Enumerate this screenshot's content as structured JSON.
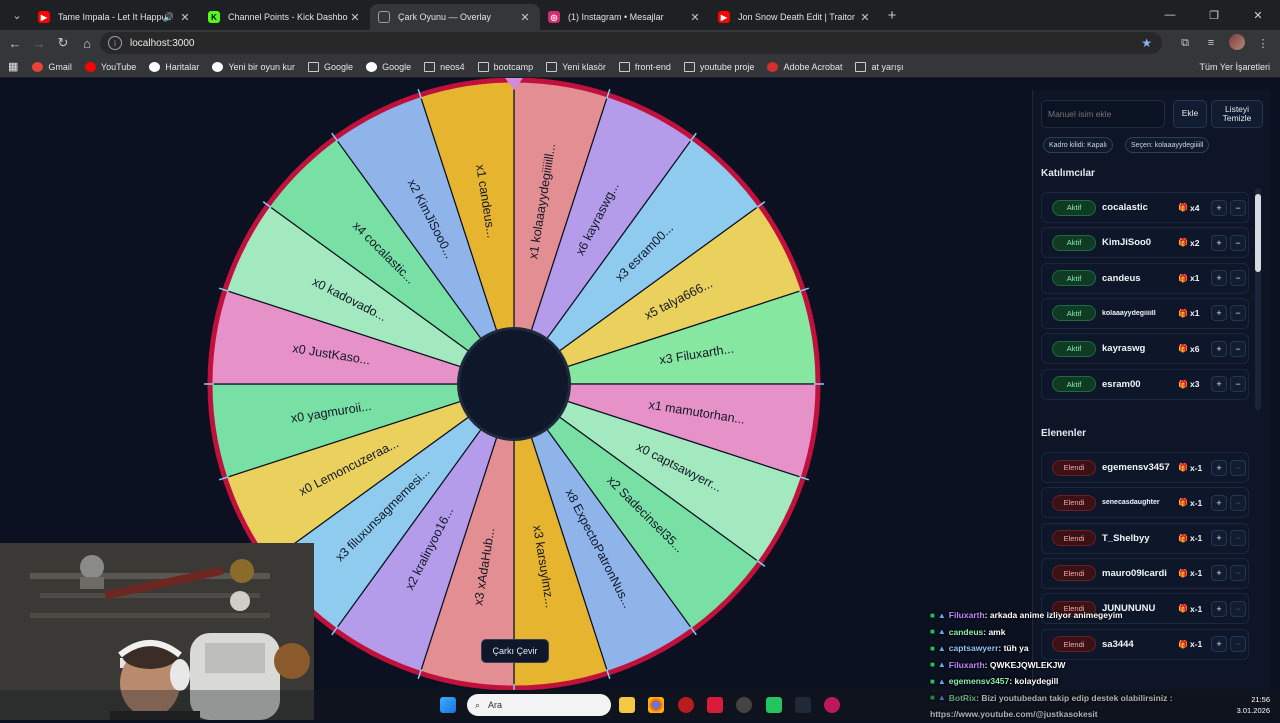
{
  "tabs": [
    {
      "title": "Tame Impala - Let It Happen",
      "color": "#ff0000",
      "glyph": "▶",
      "audio": true,
      "active": false
    },
    {
      "title": "Channel Points - Kick Dashboard",
      "color": "#53fc18",
      "glyph": "K",
      "audio": false,
      "active": false
    },
    {
      "title": "Çark Oyunu — Overlay",
      "color": "",
      "glyph": "",
      "audio": false,
      "active": true
    },
    {
      "title": "(1) Instagram • Mesajlar",
      "color": "#d62976",
      "glyph": "◎",
      "audio": false,
      "active": false
    },
    {
      "title": "Jon Snow Death Edit | Traitor",
      "color": "#ff0000",
      "glyph": "▶",
      "audio": false,
      "active": false
    }
  ],
  "address": {
    "url": "localhost:3000"
  },
  "bookmarks": [
    {
      "label": "Gmail",
      "icon": "gmail-icon",
      "color": "#ea4335"
    },
    {
      "label": "YouTube",
      "icon": "youtube-icon",
      "color": "#ff0000"
    },
    {
      "label": "Haritalar",
      "icon": "maps-icon",
      "color": "#ffffff"
    },
    {
      "label": "Yeni bir oyun kur",
      "icon": "page-icon",
      "color": "#ffffff"
    },
    {
      "label": "Google",
      "icon": "folder-icon",
      "color": ""
    },
    {
      "label": "Google",
      "icon": "google-icon",
      "color": "#ffffff"
    },
    {
      "label": "neos4",
      "icon": "folder-icon",
      "color": ""
    },
    {
      "label": "bootcamp",
      "icon": "folder-icon",
      "color": ""
    },
    {
      "label": "Yeni klasör",
      "icon": "folder-icon",
      "color": ""
    },
    {
      "label": "front-end",
      "icon": "folder-icon",
      "color": ""
    },
    {
      "label": "youtube proje",
      "icon": "folder-icon",
      "color": ""
    },
    {
      "label": "Adobe Acrobat",
      "icon": "acrobat-icon",
      "color": "#d32f2f"
    },
    {
      "label": "at yarışı",
      "icon": "folder-icon",
      "color": ""
    }
  ],
  "bookmarks_all": "Tüm Yer İşaretleri",
  "wheel": {
    "segments": [
      {
        "label": "x1 kolaaayydegiiiiill...",
        "color": "#e38e92"
      },
      {
        "label": "x6 kayraswg...",
        "color": "#b49cea"
      },
      {
        "label": "x3 esram00...",
        "color": "#8ecbee"
      },
      {
        "label": "x5 talya666...",
        "color": "#ead05c"
      },
      {
        "label": "x3 Filuxarth...",
        "color": "#86e8a0"
      },
      {
        "label": "x1 mamutorhan...",
        "color": "#e691c7"
      },
      {
        "label": "x0 captsawyerr...",
        "color": "#a2e9bf"
      },
      {
        "label": "x2 Sadecinsel35...",
        "color": "#78e0a4"
      },
      {
        "label": "x8 ExpectoPatronNus...",
        "color": "#8eb4ea"
      },
      {
        "label": "x3 karsuylmz...",
        "color": "#e7b42f"
      },
      {
        "label": "x3 xAdaHub...",
        "color": "#e38e92"
      },
      {
        "label": "x2 kralinyoo16...",
        "color": "#b49cea"
      },
      {
        "label": "x3 filuxunsagmemesi...",
        "color": "#8ecbee"
      },
      {
        "label": "x0 Lemoncuzeraa...",
        "color": "#ead05c"
      },
      {
        "label": "x0 yagmuroii...",
        "color": "#78e0a4"
      },
      {
        "label": "x0 JustKaso...",
        "color": "#e691c7"
      },
      {
        "label": "x0 kadovado...",
        "color": "#a2e9bf"
      },
      {
        "label": "x4 cocalastic...",
        "color": "#78e0a4"
      },
      {
        "label": "x2 KimJiSoo0...",
        "color": "#8eb4ea"
      },
      {
        "label": "x1 candeus...",
        "color": "#e7b42f"
      }
    ],
    "rim_color": "#c0113d",
    "hub_color": "#0f172a",
    "pointer_color": "#d18be0",
    "spin_label": "Çarkı Çevir"
  },
  "panel": {
    "input_placeholder": "Manuel isim ekle",
    "add_label": "Ekle",
    "clear_label": "Listeyi Temizle",
    "lock_chip": "Kadro kilidi: Kapalı",
    "chosen_chip": "Seçen: kolaaayydegiiiill",
    "participants_title": "Katılımcılar",
    "participants": [
      {
        "status": "Aktif",
        "name": "cocalastic",
        "mult": "x4"
      },
      {
        "status": "Aktif",
        "name": "KimJiSoo0",
        "mult": "x2"
      },
      {
        "status": "Aktif",
        "name": "candeus",
        "mult": "x1"
      },
      {
        "status": "Aktif",
        "name": "kolaaayydegiiiill",
        "mult": "x1"
      },
      {
        "status": "Aktif",
        "name": "kayraswg",
        "mult": "x6"
      },
      {
        "status": "Aktif",
        "name": "esram00",
        "mult": "x3"
      }
    ],
    "eliminated_title": "Elenenler",
    "eliminated": [
      {
        "status": "Elendi",
        "name": "egemensv3457",
        "mult": "x-1"
      },
      {
        "status": "Elendi",
        "name": "senecasdaughter",
        "mult": "x-1"
      },
      {
        "status": "Elendi",
        "name": "T_Shelbyy",
        "mult": "x-1"
      },
      {
        "status": "Elendi",
        "name": "mauro09Icardi",
        "mult": "x-1"
      },
      {
        "status": "Elendi",
        "name": "JUNUNUNU",
        "mult": "x-1"
      },
      {
        "status": "Elendi",
        "name": "sa3444",
        "mult": "x-1"
      }
    ]
  },
  "chat": [
    {
      "user": "Filuxarth",
      "user_color": "#c084fc",
      "msg": ": arkada anime izliyor animegeyim"
    },
    {
      "user": "candeus",
      "user_color": "#86efac",
      "msg": ": amk"
    },
    {
      "user": "captsawyerr",
      "user_color": "#93c5fd",
      "msg": ": tüh ya"
    },
    {
      "user": "Filuxarth",
      "user_color": "#c084fc",
      "msg": ": QWKEJQWLEKJW"
    },
    {
      "user": "egemensv3457",
      "user_color": "#86efac",
      "msg": ": kolaydegill"
    },
    {
      "user": "BotRix",
      "user_color": "#86efac",
      "msg": ": Bizi youtubedan takip edip destek olabilirsiniz :"
    },
    {
      "user": "",
      "user_color": "#ffffff",
      "msg": "https://www.youtube.com/@justkasokesit"
    }
  ],
  "taskbar": {
    "search_placeholder": "Ara",
    "time": "21:56",
    "date": "3.01.2026"
  }
}
